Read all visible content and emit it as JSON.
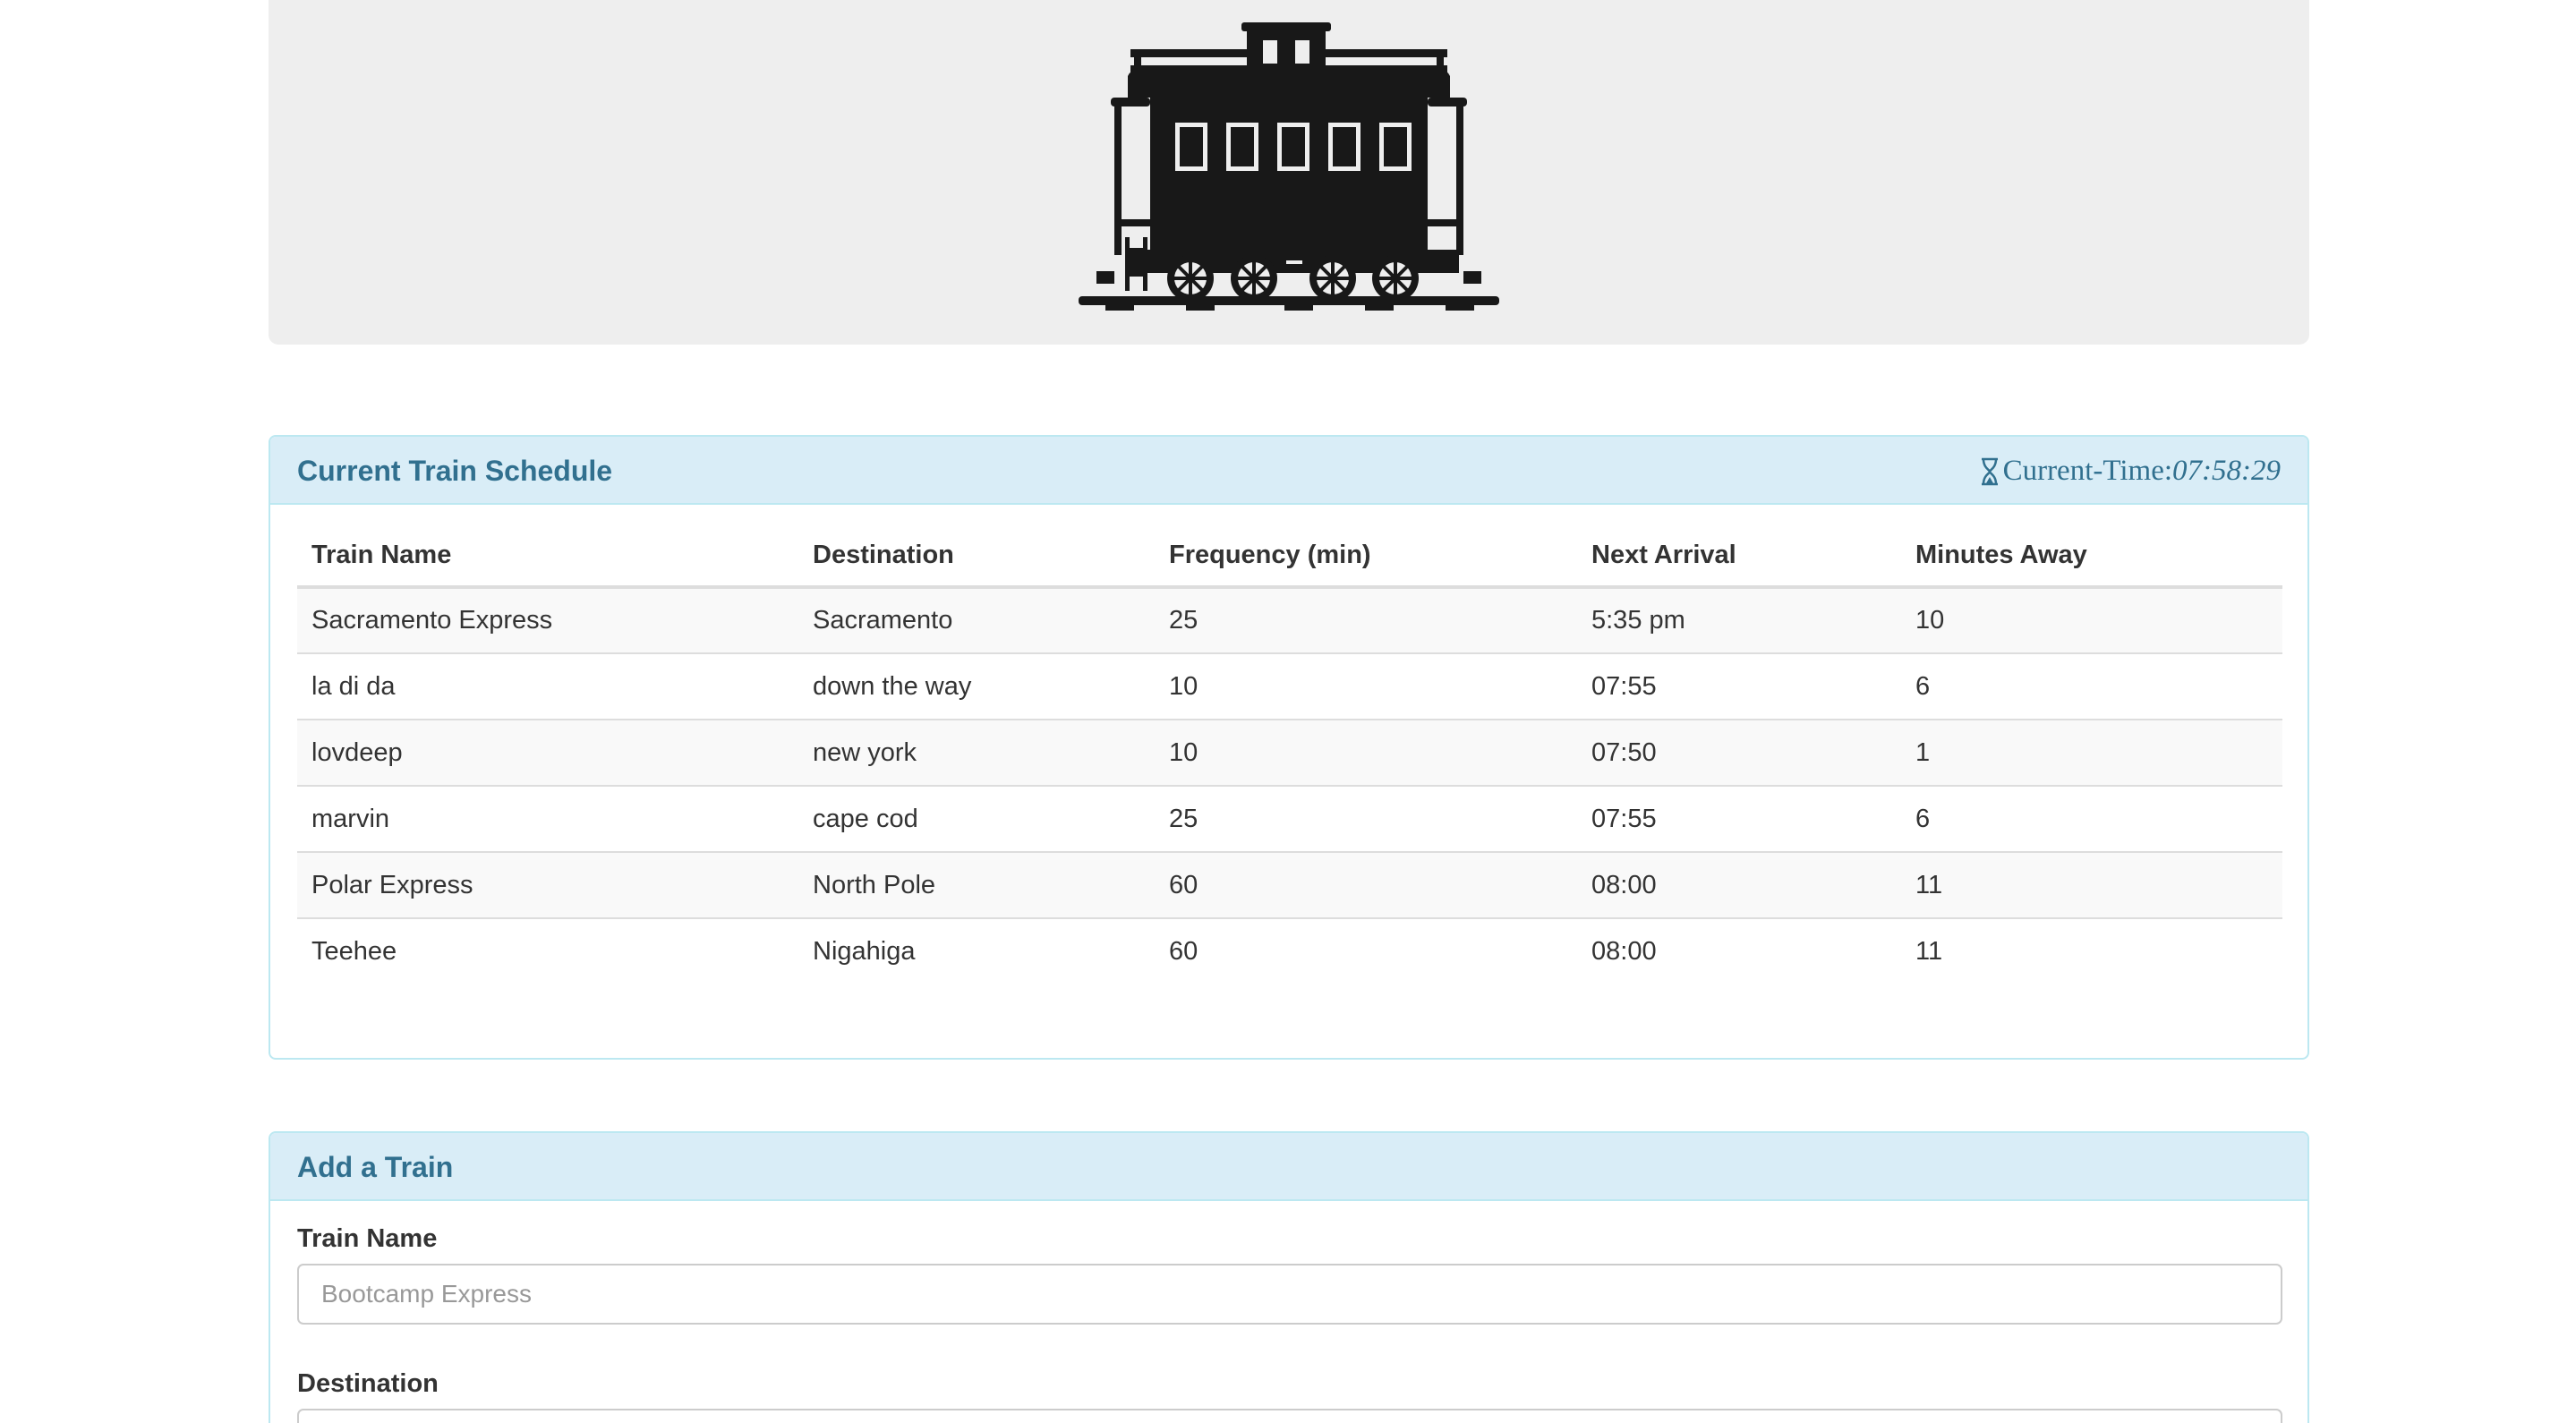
{
  "banner": {
    "logo_icon": "train-caboose-icon"
  },
  "schedule": {
    "title": "Current Train Schedule",
    "time_label": "Current-Time:",
    "time_value": "07:58:29",
    "time_icon": "hourglass-icon",
    "columns": [
      "Train Name",
      "Destination",
      "Frequency (min)",
      "Next Arrival",
      "Minutes Away"
    ],
    "rows": [
      [
        "Sacramento Express",
        "Sacramento",
        "25",
        "5:35 pm",
        "10"
      ],
      [
        "la di da",
        "down the way",
        "10",
        "07:55",
        "6"
      ],
      [
        "lovdeep",
        "new york",
        "10",
        "07:50",
        "1"
      ],
      [
        "marvin",
        "cape cod",
        "25",
        "07:55",
        "6"
      ],
      [
        "Polar Express",
        "North Pole",
        "60",
        "08:00",
        "11"
      ],
      [
        "Teehee",
        "Nigahiga",
        "60",
        "08:00",
        "11"
      ]
    ]
  },
  "add_train": {
    "title": "Add a Train",
    "train_name_label": "Train Name",
    "train_name_placeholder": "Bootcamp Express",
    "destination_label": "Destination",
    "destination_placeholder": ""
  }
}
